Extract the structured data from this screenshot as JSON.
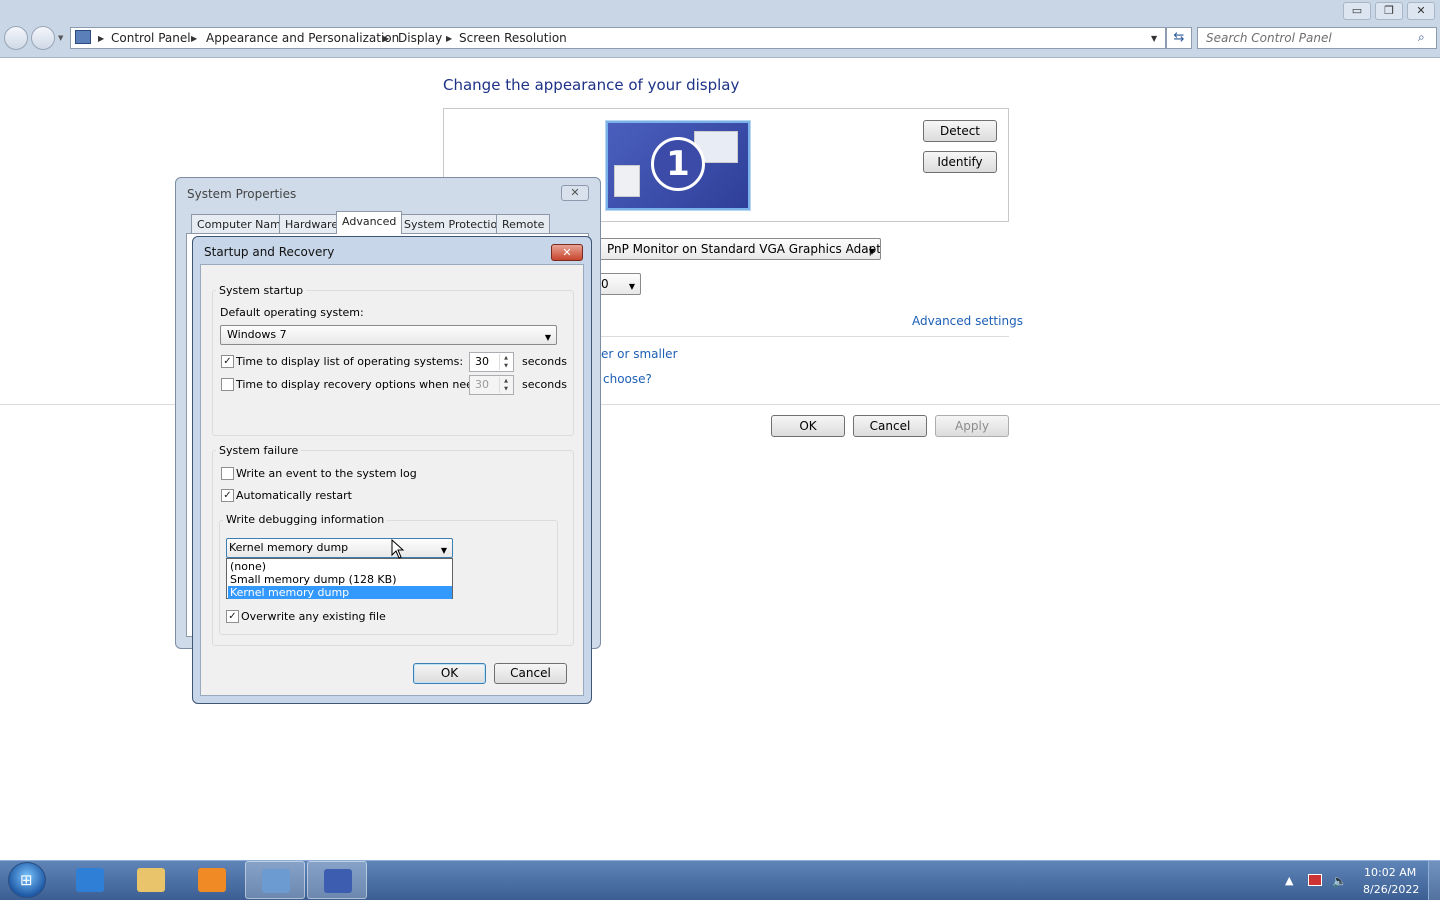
{
  "explorer": {
    "breadcrumbs": [
      "Control Panel",
      "Appearance and Personalization",
      "Display",
      "Screen Resolution"
    ],
    "search_placeholder": "Search Control Panel",
    "window_buttons": {
      "minimize": "▭",
      "restore": "❐",
      "close": "✕"
    }
  },
  "screen_resolution": {
    "title": "Change the appearance of your display",
    "monitor_number": "1",
    "detect_label": "Detect",
    "identify_label": "Identify",
    "display_value": "PnP Monitor on Standard VGA Graphics Adapter",
    "orientation_value": "0",
    "advanced_settings_link": "Advanced settings",
    "text_size_link": "er or smaller",
    "choose_link": "choose?",
    "ok_label": "OK",
    "cancel_label": "Cancel",
    "apply_label": "Apply"
  },
  "system_properties": {
    "title": "System Properties",
    "tabs": [
      "Computer Name",
      "Hardware",
      "Advanced",
      "System Protection",
      "Remote"
    ],
    "selected_tab": "Advanced"
  },
  "startup_recovery": {
    "title": "Startup and Recovery",
    "system_startup_label": "System startup",
    "default_os_label": "Default operating system:",
    "default_os_value": "Windows 7",
    "time_list_label": "Time to display list of operating systems:",
    "time_list_checked": true,
    "time_list_value": "30",
    "time_recovery_label": "Time to display recovery options when needed:",
    "time_recovery_checked": false,
    "time_recovery_value": "30",
    "seconds_label": "seconds",
    "system_failure_label": "System failure",
    "write_event_label": "Write an event to the system log",
    "write_event_checked": false,
    "auto_restart_label": "Automatically restart",
    "auto_restart_checked": true,
    "debug_info_label": "Write debugging information",
    "debug_selected": "Kernel memory dump",
    "debug_options": [
      "(none)",
      "Small memory dump (128 KB)",
      "Kernel memory dump"
    ],
    "overwrite_label": "Overwrite any existing file",
    "overwrite_checked": true,
    "ok_label": "OK",
    "cancel_label": "Cancel"
  },
  "taskbar": {
    "items": [
      {
        "name": "internet-explorer",
        "color": "#2f7fd6"
      },
      {
        "name": "windows-explorer",
        "color": "#e9c46a"
      },
      {
        "name": "media-player",
        "color": "#f08a24"
      },
      {
        "name": "control-panel",
        "color": "#6b9bd1"
      },
      {
        "name": "system-properties",
        "color": "#3d5db0"
      }
    ],
    "time": "10:02 AM",
    "date": "8/26/2022"
  }
}
